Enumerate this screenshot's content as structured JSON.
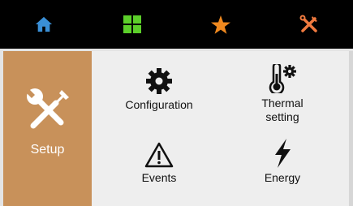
{
  "nav": {
    "items": [
      {
        "name": "home",
        "icon": "home-icon",
        "color": "#3a8fd6"
      },
      {
        "name": "apps",
        "icon": "grid-icon",
        "color": "#5ccf2a"
      },
      {
        "name": "favorites",
        "icon": "star-icon",
        "color": "#f0891f"
      },
      {
        "name": "setup",
        "icon": "tools-icon",
        "color": "#f07a3f"
      }
    ]
  },
  "side": {
    "label": "Setup",
    "icon": "tools-icon",
    "background": "#c8915a"
  },
  "tiles": {
    "configuration": {
      "label": "Configuration",
      "icon": "gear-icon"
    },
    "thermal": {
      "label": "Thermal\nsetting",
      "icon": "thermometer-gear-icon"
    },
    "events": {
      "label": "Events",
      "icon": "warning-icon"
    },
    "energy": {
      "label": "Energy",
      "icon": "lightning-icon"
    }
  }
}
